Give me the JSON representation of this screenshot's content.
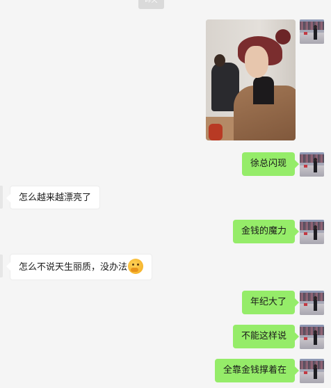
{
  "time_badge": "昨天",
  "messages": [
    {
      "side": "out",
      "kind": "image",
      "avatar_icon": "profile-photo-avatar"
    },
    {
      "side": "out",
      "kind": "text",
      "text": "徐总闪现"
    },
    {
      "side": "in",
      "kind": "text",
      "text": "怎么越来越漂亮了"
    },
    {
      "side": "out",
      "kind": "text",
      "text": "金钱的魔力"
    },
    {
      "side": "in",
      "kind": "text",
      "text": "怎么不说天生丽质，没办法",
      "emoji": "thinking-face-emoji"
    },
    {
      "side": "out",
      "kind": "text",
      "text": "年纪大了"
    },
    {
      "side": "out",
      "kind": "text",
      "text": "不能这样说"
    },
    {
      "side": "out",
      "kind": "text",
      "text": "全靠金钱撑着在"
    }
  ],
  "colors": {
    "background": "#f5f5f5",
    "outgoing_bubble": "#95ec69",
    "incoming_bubble": "#ffffff"
  }
}
